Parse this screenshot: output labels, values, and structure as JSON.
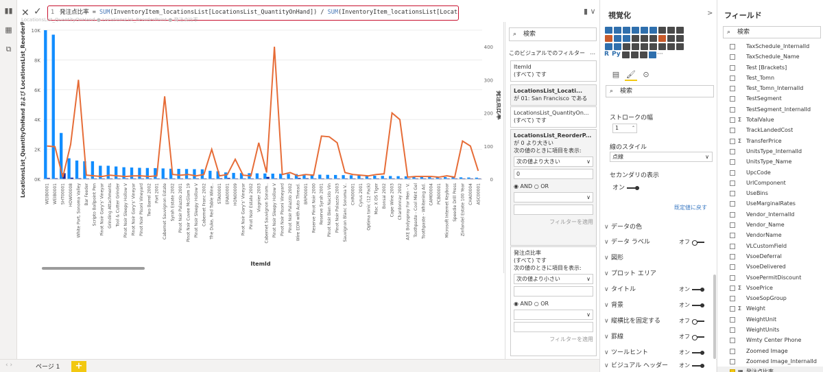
{
  "formula": {
    "line_no": "1",
    "name_part": "発注点比率 = ",
    "fn1": "SUM",
    "arg1": "(InventoryItem_locationsList[LocationsList_QuantityOnHand]) / ",
    "fn2": "SUM",
    "arg2": "(InventoryItem_locationsList[LocationsList_ReorderPoint])"
  },
  "chart_data": {
    "type": "bar",
    "legend_ghost": "LocationsList_QuantityOnHand ● LocationsList_ReorderPoint ● 発注点比率",
    "ylabel": "LocationsList_QuantityOnHand および LocationsList_ReorderPoint",
    "y2label": "発注点比率",
    "xlabel": "ItemId",
    "y_ticks": [
      "0K",
      "2K",
      "4K",
      "6K",
      "8K",
      "10K"
    ],
    "y2_ticks": [
      "0",
      "100",
      "200",
      "300",
      "400"
    ],
    "ylim": [
      0,
      10000
    ],
    "y2lim": [
      0,
      450
    ],
    "categories": [
      "WEIB0001",
      "WEIB0001",
      "SHT00001",
      "HOW00008",
      "White Port, Sonoma Valley 2...",
      "Bar Feeder",
      "Scripto Ballpoint Pen",
      "Pinot Noir Gary's' Vineyard 2...",
      "Grinding Attachments",
      "Tool & Cutter Grinder",
      "Pinot Noir Sleepy Hollow Vi...",
      "Pinot Noir Gary's' Vineyard 2...",
      "Pinot Noir Pisoni Vineyard 2...",
      "Two Barrel 2002",
      "Port 2001",
      "Cabernet Sauvignon Estate ...",
      "Syrah Estate 2002",
      "Pinot Noir Palazzio 2001",
      "Pinot Noir Cuvee McGlam 19...",
      "Pinot Noir Sleepy Hollow Vi...",
      "Cabernet Franc 2002",
      "The Duke, Red Table Wine...",
      "STA00001",
      "ERA00001",
      "HON00009",
      "Pinot Noir Gary's' Vineyard 2...",
      "Pinot Noir Estate 2002",
      "Viognier 2003",
      "Cabernet Sauvignon Sonom...",
      "Pinot Noir Sleepy Hollow Vi...",
      "Pinot Noir Pisoni Vineyard...",
      "Pinot Noir Palazzio 2002",
      "Wire EDM with Auto Thread...",
      "BRP00001",
      "Reserve Pinot Noir 2000",
      "Reserve Syrah 2001",
      "Pinot Noir Bien Nacido Vine...",
      "Pinot Noir Palazzio 2003",
      "Sauvignon Blanc Sonoma V...",
      "CHR00001",
      "Cyrus 2001",
      "Optima tonic (12 Pack)",
      "Mac X OS Tiger",
      "Bonsai 2002",
      "Cape Wine 2003",
      "Chardonnay 2002",
      "AXE Bodyspray For Men - V...",
      "Toothpaste - Cool Mint Gel",
      "Toothpaste - Whitening Ad...",
      "CAM00004",
      "PCB00001",
      "Microsoft Internet Keyboard",
      "Speedie Drill Press",
      "Zinfandel Estate 100 Year Ol...",
      "CHA00004",
      "ASC00001"
    ],
    "series": [
      {
        "name": "LocationsList_QuantityOnHand",
        "values": [
          10000,
          9700,
          3100,
          1400,
          1250,
          1200,
          1200,
          900,
          900,
          850,
          800,
          780,
          760,
          750,
          740,
          720,
          700,
          690,
          680,
          670,
          660,
          560,
          530,
          450,
          420,
          410,
          400,
          390,
          380,
          370,
          360,
          350,
          340,
          330,
          320,
          300,
          290,
          280,
          270,
          260,
          250,
          240,
          230,
          220,
          210,
          200,
          190,
          180,
          170,
          160,
          150,
          140,
          130,
          120,
          110,
          100
        ]
      },
      {
        "name": "LocationsList_ReorderPoint",
        "values": [
          80,
          60,
          400,
          100,
          60,
          30,
          30,
          20,
          40,
          30,
          50,
          30,
          20,
          30,
          10,
          60,
          20,
          40,
          30,
          50,
          20,
          20,
          60,
          80,
          20,
          20,
          30,
          20,
          150,
          50,
          40,
          20,
          80,
          60,
          20,
          30,
          20,
          40,
          20,
          30,
          20,
          10,
          20,
          20,
          20,
          20,
          20,
          10,
          20,
          10,
          10,
          10,
          20,
          10,
          10,
          10
        ]
      },
      {
        "name": "発注点比率",
        "values": [
          100,
          98,
          6,
          105,
          300,
          12,
          10,
          8,
          12,
          10,
          8,
          10,
          10,
          8,
          10,
          250,
          14,
          12,
          14,
          10,
          14,
          90,
          10,
          14,
          60,
          12,
          10,
          110,
          20,
          400,
          14,
          20,
          10,
          14,
          12,
          130,
          128,
          110,
          20,
          14,
          12,
          10,
          14,
          16,
          200,
          180,
          6,
          8,
          8,
          8,
          6,
          10,
          6,
          115,
          100,
          25
        ]
      }
    ]
  },
  "filters": {
    "search": "検索",
    "header": "このビジュアルでのフィルター",
    "header_more": "...",
    "cards": [
      {
        "title": "ItemId",
        "value": "(すべて) です"
      },
      {
        "title": "LocationsList_Locati...",
        "value": "が 01: San Francisco である"
      },
      {
        "title": "LocationsList_QuantityOn...",
        "value": "(すべて) です"
      },
      {
        "title": "LocationsList_ReorderP...",
        "value": "が 0 より大きい",
        "show_label": "次の値のときに項目を表示:",
        "op1": "次の値より大きい",
        "val1": "0",
        "and": "AND",
        "or": "OR",
        "apply": "フィルターを適用"
      },
      {
        "title": "発注点比率",
        "value": "(すべて) です",
        "show_label": "次の値のときに項目を表示:",
        "op1": "次の値より小さい",
        "and": "AND",
        "or": "OR",
        "apply": "フィルターを適用"
      }
    ]
  },
  "viz": {
    "title": "視覚化",
    "arrow": ">",
    "search": "検索",
    "stroke_label": "ストロークの幅",
    "stroke_value": "1",
    "line_style_label": "線のスタイル",
    "line_style_value": "点線",
    "secondary_label": "セカンダリの表示",
    "secondary_toggle": "オン",
    "reset": "既定値に戻す",
    "sections": [
      {
        "label": "データの色",
        "toggle": ""
      },
      {
        "label": "データ ラベル",
        "toggle": "オフ"
      },
      {
        "label": "図形",
        "toggle": ""
      },
      {
        "label": "プロット エリア",
        "toggle": ""
      },
      {
        "label": "タイトル",
        "toggle": "オン"
      },
      {
        "label": "背景",
        "toggle": "オン"
      },
      {
        "label": "縦横比を固定する",
        "toggle": "オフ"
      },
      {
        "label": "罫線",
        "toggle": "オフ"
      },
      {
        "label": "ツールヒント",
        "toggle": "オン"
      },
      {
        "label": "ビジュアル ヘッダー",
        "toggle": "オン"
      }
    ],
    "r_label": "R",
    "py_label": "Py"
  },
  "fields": {
    "title": "フィールド",
    "arrow": ">",
    "search": "検索",
    "items": [
      {
        "name": "TaxSchedule_InternalId",
        "sigma": false,
        "checked": false
      },
      {
        "name": "TaxSchedule_Name",
        "sigma": false,
        "checked": false
      },
      {
        "name": "Test [Brackets]",
        "sigma": false,
        "checked": false
      },
      {
        "name": "Test_Tomn",
        "sigma": false,
        "checked": false
      },
      {
        "name": "Test_Tomn_InternalId",
        "sigma": false,
        "checked": false
      },
      {
        "name": "TestSegment",
        "sigma": false,
        "checked": false
      },
      {
        "name": "TestSegment_InternalId",
        "sigma": false,
        "checked": false
      },
      {
        "name": "TotalValue",
        "sigma": true,
        "checked": false
      },
      {
        "name": "TrackLandedCost",
        "sigma": false,
        "checked": false
      },
      {
        "name": "TransferPrice",
        "sigma": true,
        "checked": false
      },
      {
        "name": "UnitsType_InternalId",
        "sigma": false,
        "checked": false
      },
      {
        "name": "UnitsType_Name",
        "sigma": false,
        "checked": false
      },
      {
        "name": "UpcCode",
        "sigma": false,
        "checked": false
      },
      {
        "name": "UrlComponent",
        "sigma": false,
        "checked": false
      },
      {
        "name": "UseBins",
        "sigma": false,
        "checked": false
      },
      {
        "name": "UseMarginalRates",
        "sigma": false,
        "checked": false
      },
      {
        "name": "Vendor_InternalId",
        "sigma": false,
        "checked": false
      },
      {
        "name": "Vendor_Name",
        "sigma": false,
        "checked": false
      },
      {
        "name": "VendorName",
        "sigma": false,
        "checked": false
      },
      {
        "name": "VLCustomField",
        "sigma": false,
        "checked": false
      },
      {
        "name": "VsoeDeferral",
        "sigma": false,
        "checked": false
      },
      {
        "name": "VsoeDelivered",
        "sigma": false,
        "checked": false
      },
      {
        "name": "VsoePermitDiscount",
        "sigma": false,
        "checked": false
      },
      {
        "name": "VsoePrice",
        "sigma": true,
        "checked": false
      },
      {
        "name": "VsoeSopGroup",
        "sigma": false,
        "checked": false
      },
      {
        "name": "Weight",
        "sigma": true,
        "checked": false
      },
      {
        "name": "WeightUnit",
        "sigma": false,
        "checked": false
      },
      {
        "name": "WeightUnits",
        "sigma": false,
        "checked": false
      },
      {
        "name": "Wmty Center Phone",
        "sigma": false,
        "checked": false
      },
      {
        "name": "Zoomed Image",
        "sigma": false,
        "checked": false
      },
      {
        "name": "Zoomed Image_InternalId",
        "sigma": false,
        "checked": false
      },
      {
        "name": "発注点比率",
        "sigma": false,
        "checked": true,
        "measure": true
      }
    ]
  },
  "pages": {
    "tab": "ページ 1",
    "add": "+"
  },
  "colors": {
    "bar1": "#118DFF",
    "bar2": "#12239E",
    "line": "#E66C37",
    "accent": "#F2C811",
    "formula_border": "#C8102E"
  }
}
